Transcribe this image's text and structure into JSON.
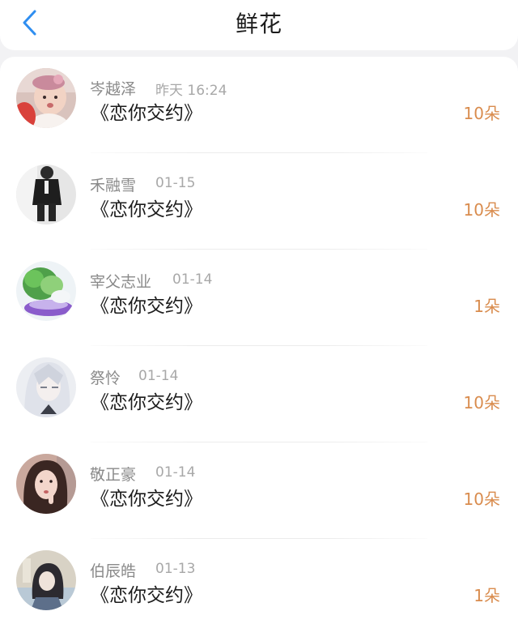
{
  "header": {
    "title": "鲜花"
  },
  "records": [
    {
      "name": "岑越泽",
      "time": "昨天 16:24",
      "book": "《恋你交约》",
      "amount": "10朵",
      "avatar": "baby-photo"
    },
    {
      "name": "禾融雪",
      "time": "01-15",
      "book": "《恋你交约》",
      "amount": "10朵",
      "avatar": "suit-figure-photo"
    },
    {
      "name": "宰父志业",
      "time": "01-14",
      "book": "《恋你交约》",
      "amount": "1朵",
      "avatar": "cabbage-photo"
    },
    {
      "name": "祭怜",
      "time": "01-14",
      "book": "《恋你交约》",
      "amount": "10朵",
      "avatar": "anime-character"
    },
    {
      "name": "敬正豪",
      "time": "01-14",
      "book": "《恋你交约》",
      "amount": "10朵",
      "avatar": "girl-photo"
    },
    {
      "name": "伯辰皓",
      "time": "01-13",
      "book": "《恋你交约》",
      "amount": "1朵",
      "avatar": "sketch-figure-photo"
    }
  ],
  "colors": {
    "accent_amount": "#d98c4e",
    "back_arrow": "#2f8ef0"
  }
}
